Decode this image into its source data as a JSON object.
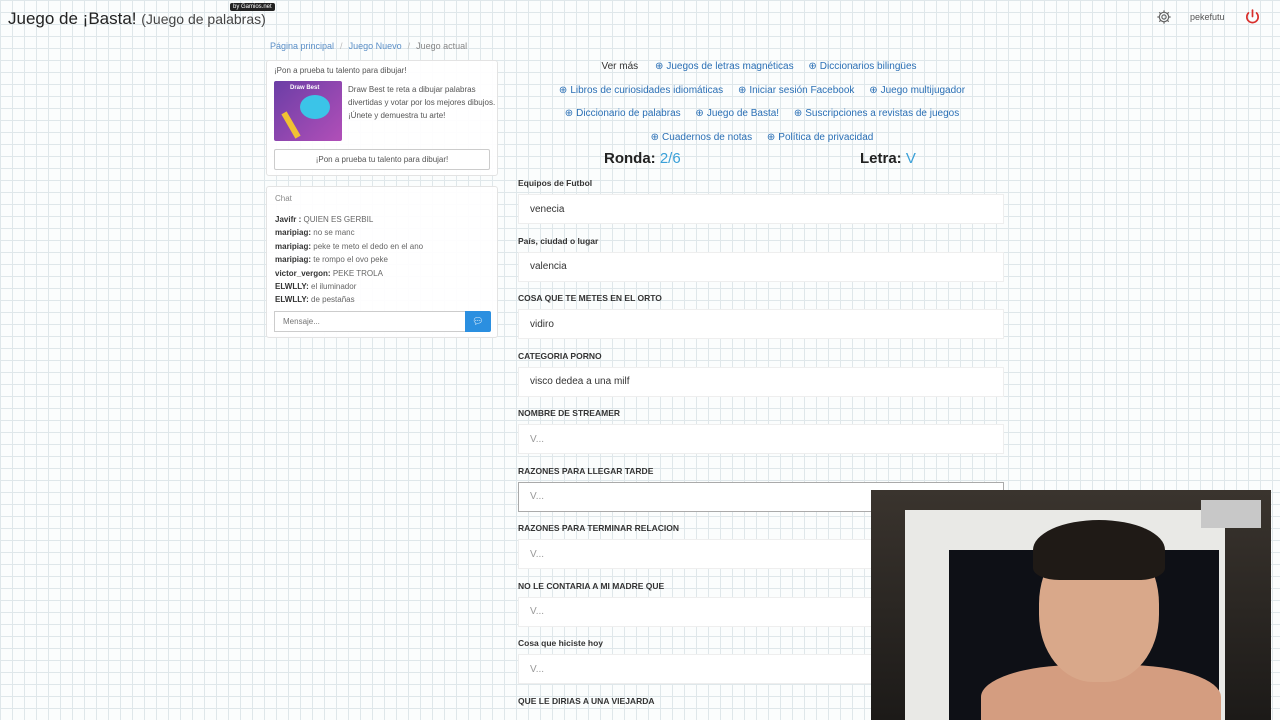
{
  "header": {
    "title": "Juego de ¡Basta!",
    "subtitle": "(Juego de palabras)",
    "badge": "by Gamios.net",
    "username": "pekefutu"
  },
  "breadcrumb": [
    "Página principal",
    "Juego Nuevo",
    "Juego actual"
  ],
  "promo": {
    "title": "¡Pon a prueba tu talento para dibujar!",
    "image_label": "Draw Best",
    "text": "Draw Best te reta a dibujar palabras divertidas y votar por los mejores dibujos. ¡Únete y demuestra tu arte!",
    "button": "¡Pon a prueba tu talento para dibujar!"
  },
  "chat": {
    "title": "Chat",
    "messages": [
      {
        "user": "Javifr :",
        "text": "QUIEN ES GERBIL"
      },
      {
        "user": "maripiag:",
        "text": "no se manc"
      },
      {
        "user": "maripiag:",
        "text": "peke te meto el dedo en el ano"
      },
      {
        "user": "maripiag:",
        "text": "te rompo el ovo peke"
      },
      {
        "user": "victor_vergon:",
        "text": "PEKE TROLA"
      },
      {
        "user": "ELWLLY:",
        "text": "el iluminador"
      },
      {
        "user": "ELWLLY:",
        "text": "de pestañas"
      }
    ],
    "input_placeholder": "Mensaje...",
    "send_icon": "chat-bubble-icon"
  },
  "links": {
    "more": "Ver más",
    "items": [
      "Juegos de letras magnéticas",
      "Diccionarios bilingües",
      "Libros de curiosidades idiomáticas",
      "Iniciar sesión Facebook",
      "Juego multijugador",
      "Diccionario de palabras",
      "Juego de Basta!",
      "Suscripciones a revistas de juegos",
      "Cuadernos de notas",
      "Política de privacidad"
    ]
  },
  "game": {
    "round_label": "Ronda:",
    "round_value": "2/6",
    "letter_label": "Letra:",
    "letter_value": "V"
  },
  "fields": [
    {
      "label": "Equipos de Futbol",
      "value": "venecia",
      "placeholder": "V..."
    },
    {
      "label": "País, ciudad o lugar",
      "value": "valencia",
      "placeholder": "V..."
    },
    {
      "label": "COSA QUE TE METES EN EL ORTO",
      "value": "vidiro",
      "placeholder": "V..."
    },
    {
      "label": "CATEGORIA PORNO",
      "value": "visco dedea a una milf",
      "placeholder": "V..."
    },
    {
      "label": "NOMBRE DE STREAMER",
      "value": "",
      "placeholder": "V..."
    },
    {
      "label": "RAZONES PARA LLEGAR TARDE",
      "value": "",
      "placeholder": "V..."
    },
    {
      "label": "RAZONES PARA TERMINAR RELACION",
      "value": "",
      "placeholder": "V..."
    },
    {
      "label": "NO LE CONTARIA A MI MADRE QUE",
      "value": "",
      "placeholder": "V..."
    },
    {
      "label": "Cosa que hiciste hoy",
      "value": "",
      "placeholder": "V..."
    },
    {
      "label": "QUE LE DIRIAS A UNA VIEJARDA",
      "value": "",
      "placeholder": "V..."
    }
  ],
  "colors": {
    "accent": "#3aa0d8",
    "link": "#2a6fb5",
    "power": "#d9302c",
    "send_button": "#2b8fe0"
  }
}
